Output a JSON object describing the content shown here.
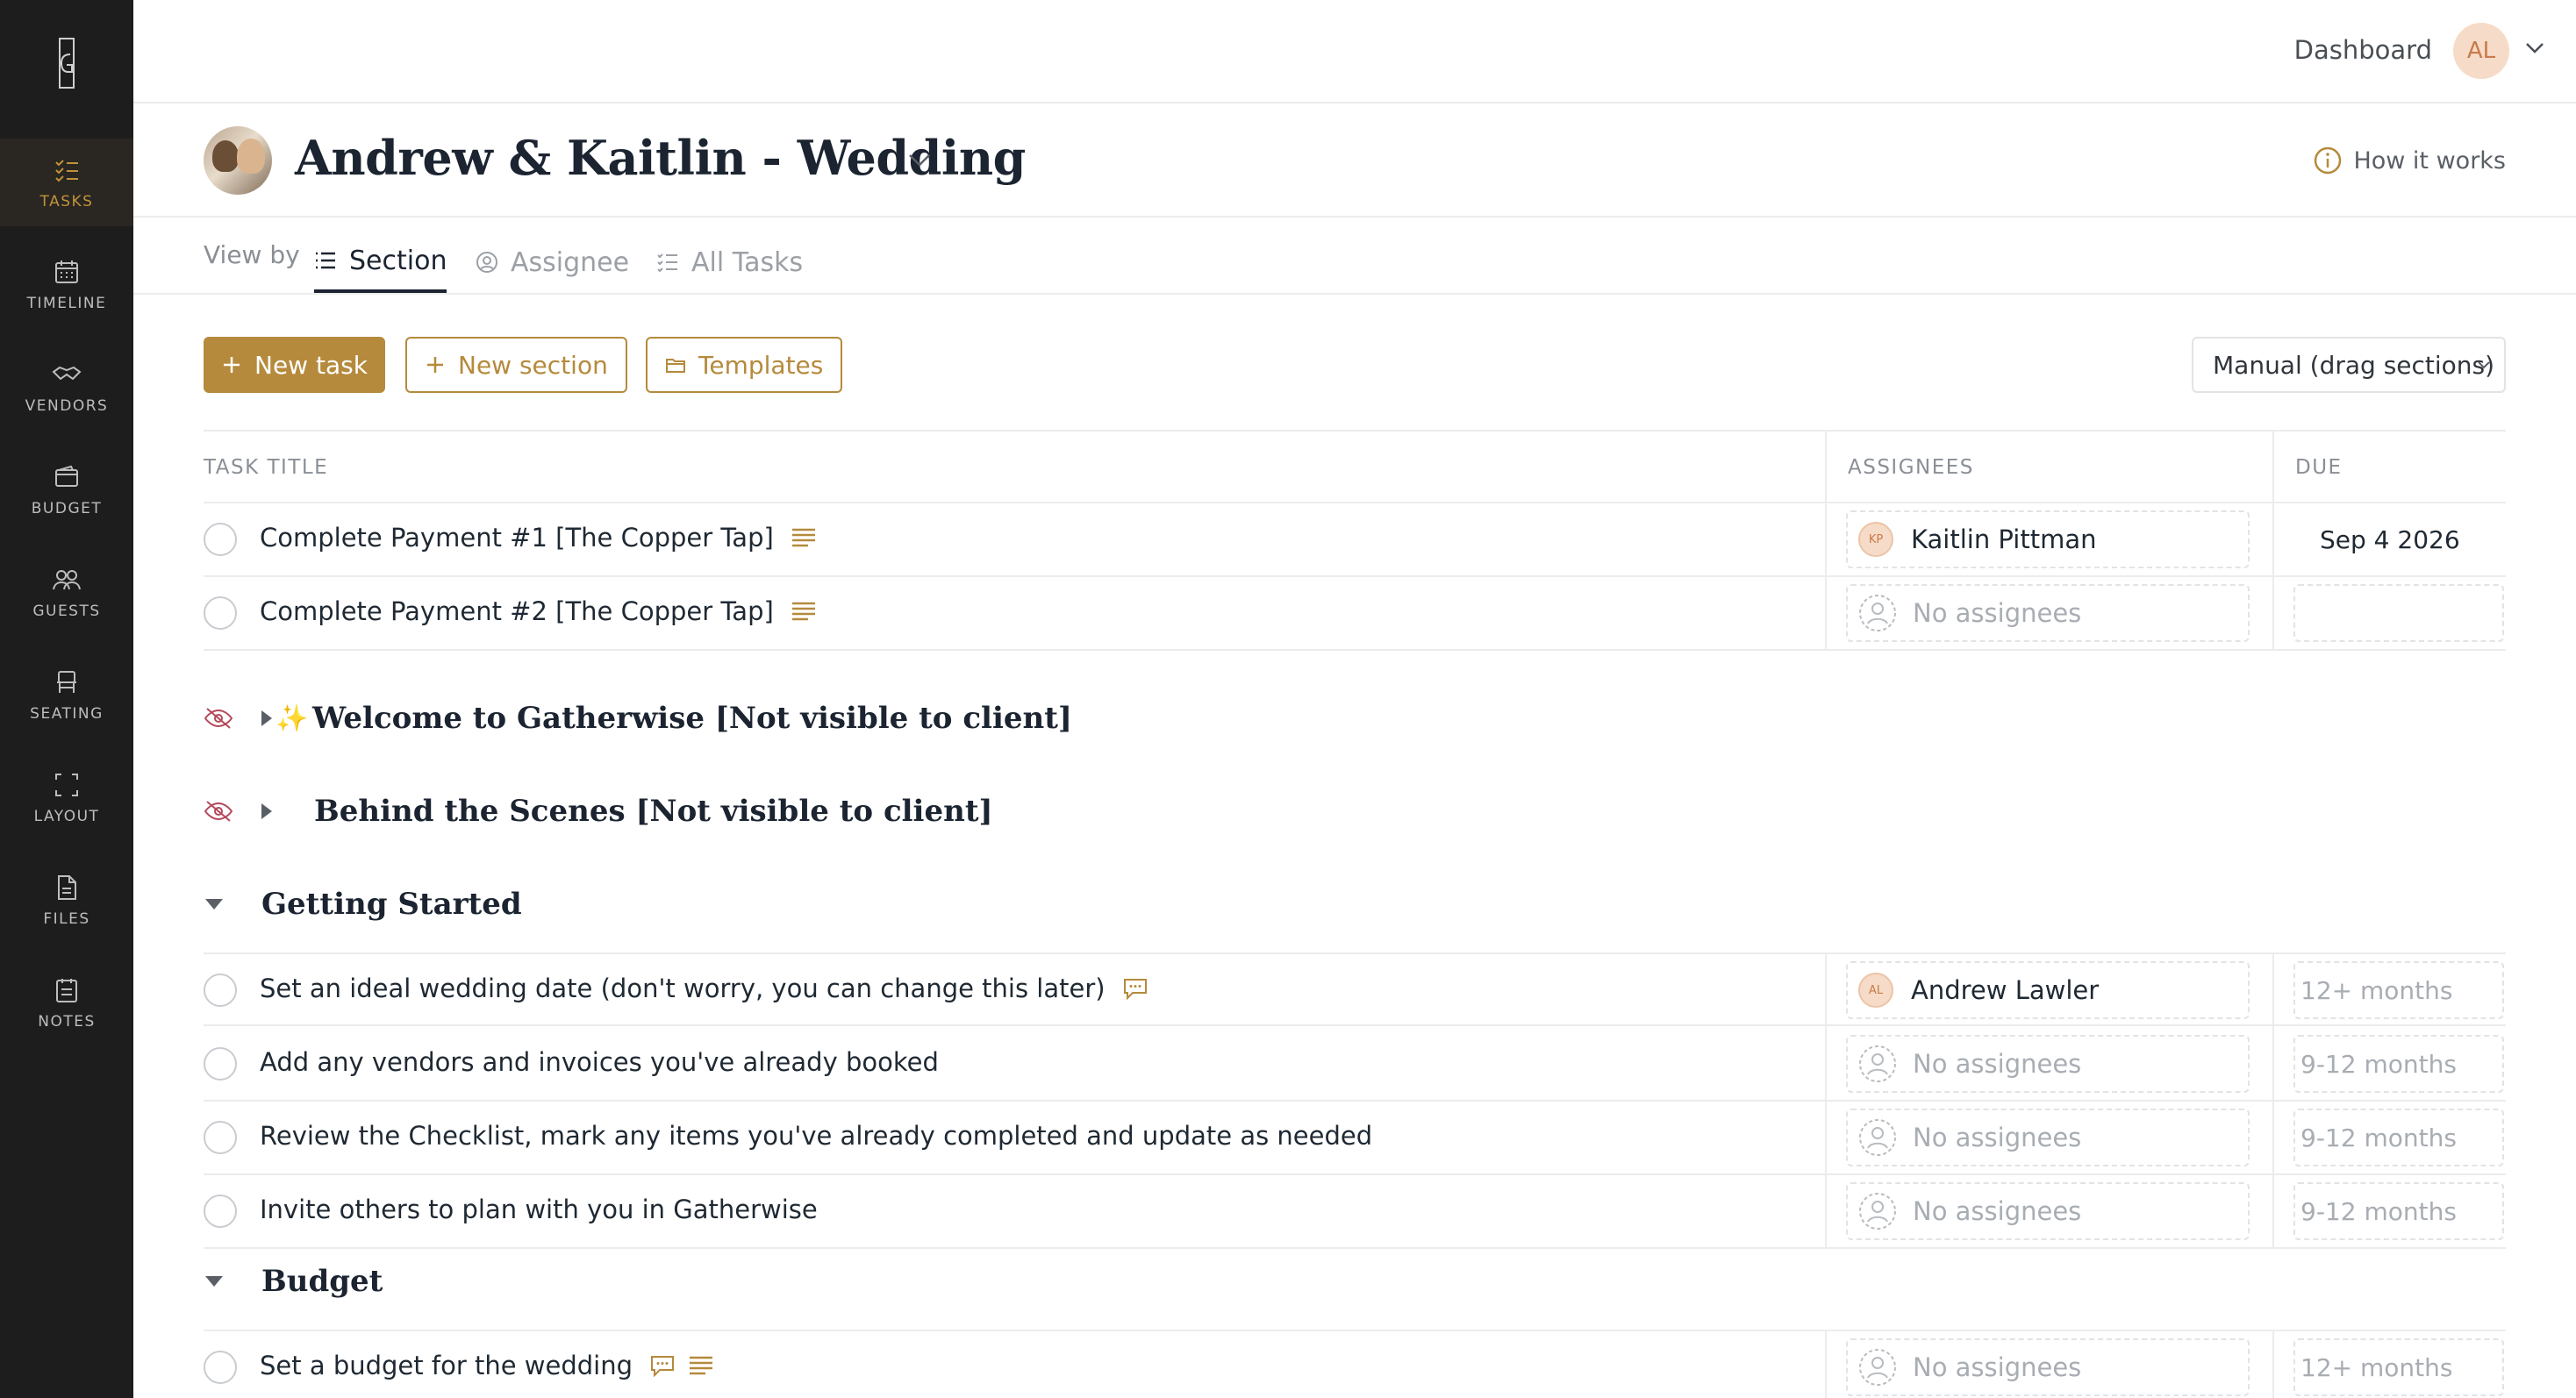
{
  "sidebar": {
    "items": [
      {
        "label": "TASKS",
        "icon": "tasks-icon",
        "active": true
      },
      {
        "label": "TIMELINE",
        "icon": "calendar-icon",
        "active": false
      },
      {
        "label": "VENDORS",
        "icon": "handshake-icon",
        "active": false
      },
      {
        "label": "BUDGET",
        "icon": "wallet-icon",
        "active": false
      },
      {
        "label": "GUESTS",
        "icon": "people-icon",
        "active": false
      },
      {
        "label": "SEATING",
        "icon": "chair-icon",
        "active": false
      },
      {
        "label": "LAYOUT",
        "icon": "layout-icon",
        "active": false
      },
      {
        "label": "FILES",
        "icon": "file-icon",
        "active": false
      },
      {
        "label": "NOTES",
        "icon": "notes-icon",
        "active": false
      }
    ]
  },
  "topbar": {
    "dashboard_label": "Dashboard",
    "user_initials": "AL"
  },
  "header": {
    "project_title": "Andrew & Kaitlin - Wedding",
    "how_it_works": "How it works"
  },
  "view_tabs": {
    "view_by_label": "View by",
    "tabs": [
      {
        "label": "Section",
        "active": true
      },
      {
        "label": "Assignee",
        "active": false
      },
      {
        "label": "All Tasks",
        "active": false
      }
    ]
  },
  "toolbar": {
    "new_task": "New task",
    "new_section": "New section",
    "templates": "Templates",
    "sort_value": "Manual (drag sections)"
  },
  "table": {
    "columns": [
      "TASK TITLE",
      "ASSIGNEES",
      "DUE"
    ],
    "top_tasks": [
      {
        "title": "Complete Payment #1 [The Copper Tap]",
        "assignee": "Kaitlin Pittman",
        "initials": "KP",
        "due": "Sep 4 2026"
      },
      {
        "title": "Complete Payment #2 [The Copper Tap]",
        "assignee": "No assignees",
        "initials": "",
        "due": ""
      }
    ],
    "hidden_sections": [
      {
        "prefix": "✨",
        "title": "Welcome to Gatherwise [Not visible to client]"
      },
      {
        "prefix": "",
        "title": "Behind the Scenes [Not visible to client]"
      }
    ],
    "sections": [
      {
        "title": "Getting Started",
        "tasks": [
          {
            "title": "Set an ideal wedding date (don't worry, you can change this later)",
            "assignee": "Andrew Lawler",
            "initials": "AL",
            "due": "12+ months"
          },
          {
            "title": "Add any vendors and invoices you've already booked",
            "assignee": "No assignees",
            "initials": "",
            "due": "9-12 months"
          },
          {
            "title": "Review the Checklist, mark any items you've already completed and update as needed",
            "assignee": "No assignees",
            "initials": "",
            "due": "9-12 months"
          },
          {
            "title": "Invite others to plan with you in Gatherwise",
            "assignee": "No assignees",
            "initials": "",
            "due": "9-12 months"
          }
        ]
      },
      {
        "title": "Budget",
        "tasks": [
          {
            "title": "Set a budget for the wedding",
            "assignee": "No assignees",
            "initials": "",
            "due": "12+ months"
          }
        ]
      }
    ]
  },
  "colors": {
    "accent": "#b58a3c",
    "sidebar_bg": "#1d1d1d",
    "hidden_icon": "#b5485a"
  }
}
